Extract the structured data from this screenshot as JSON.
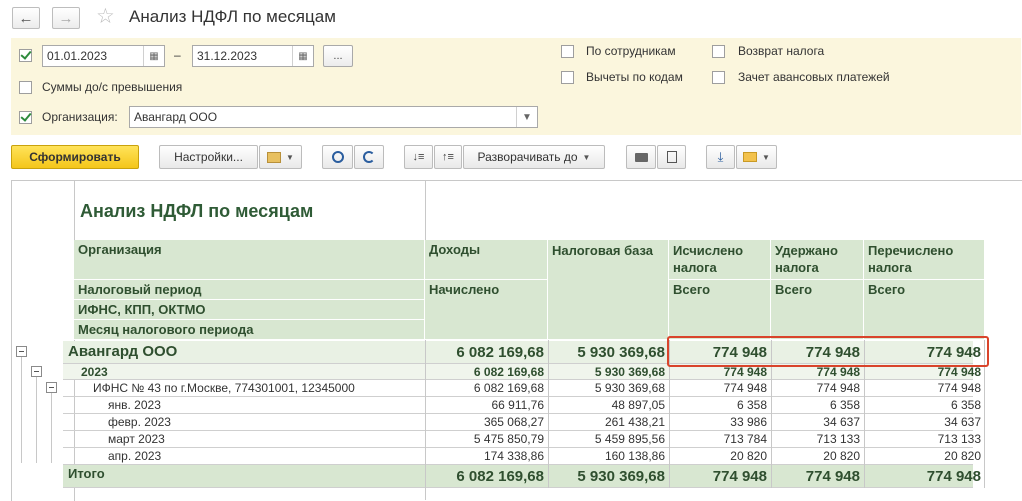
{
  "window": {
    "title": "Анализ НДФЛ по месяцам"
  },
  "filters": {
    "date_from": "01.01.2023",
    "date_dash": "–",
    "date_to": "31.12.2023",
    "more_btn": "...",
    "sums_label": "Суммы до/с превышения",
    "org_label": "Организация:",
    "org_value": "Авангард ООО",
    "by_employees": "По сотрудникам",
    "deductions": "Вычеты по кодам",
    "tax_return": "Возврат налога",
    "advance_offset": "Зачет авансовых платежей"
  },
  "toolbar": {
    "generate": "Сформировать",
    "settings": "Настройки...",
    "expand_to": "Разворачивать до"
  },
  "report": {
    "title": "Анализ НДФЛ по месяцам",
    "headers": {
      "organization": "Организация",
      "tax_period": "Налоговый период",
      "ifns": "ИФНС, КПП, ОКТМО",
      "month": "Месяц налогового периода",
      "income": "Доходы",
      "accrued": "Начислено",
      "tax_base": "Налоговая база",
      "calculated": "Исчислено налога",
      "withheld": "Удержано налога",
      "transferred": "Перечислено налога",
      "total_sub": "Всего"
    },
    "rows": [
      {
        "label": "Авангард ООО",
        "income": "6 082 169,68",
        "base": "5 930 369,68",
        "calc": "774 948",
        "held": "774 948",
        "paid": "774 948"
      },
      {
        "label": "2023",
        "income": "6 082 169,68",
        "base": "5 930 369,68",
        "calc": "774 948",
        "held": "774 948",
        "paid": "774 948"
      },
      {
        "label": "ИФНС № 43 по г.Москве, 774301001, 12345000",
        "income": "6 082 169,68",
        "base": "5 930 369,68",
        "calc": "774 948",
        "held": "774 948",
        "paid": "774 948"
      },
      {
        "label": "янв. 2023",
        "income": "66 911,76",
        "base": "48 897,05",
        "calc": "6 358",
        "held": "6 358",
        "paid": "6 358"
      },
      {
        "label": "февр. 2023",
        "income": "365 068,27",
        "base": "261 438,21",
        "calc": "33 986",
        "held": "34 637",
        "paid": "34 637"
      },
      {
        "label": "март 2023",
        "income": "5 475 850,79",
        "base": "5 459 895,56",
        "calc": "713 784",
        "held": "713 133",
        "paid": "713 133"
      },
      {
        "label": "апр. 2023",
        "income": "174 338,86",
        "base": "160 138,86",
        "calc": "20 820",
        "held": "20 820",
        "paid": "20 820"
      }
    ],
    "total": {
      "label": "Итого",
      "income": "6 082 169,68",
      "base": "5 930 369,68",
      "calc": "774 948",
      "held": "774 948",
      "paid": "774 948"
    }
  },
  "colors": {
    "accent": "#f4c61a",
    "header_bg": "#d8e7d1",
    "panel_bg": "#fbf6dd",
    "highlight": "#d9442b"
  }
}
